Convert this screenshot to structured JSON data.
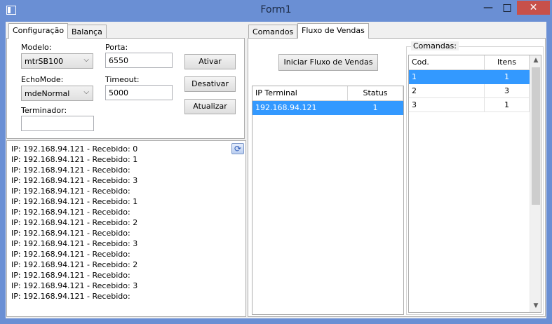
{
  "window": {
    "title": "Form1",
    "minimize": "—",
    "maximize": "□",
    "close": "✕"
  },
  "left_tabs": [
    {
      "label": "Configuração"
    },
    {
      "label": "Balança"
    }
  ],
  "config": {
    "modelo_label": "Modelo:",
    "modelo_value": "mtrSB100",
    "porta_label": "Porta:",
    "porta_value": "6550",
    "echomode_label": "EchoMode:",
    "echomode_value": "mdeNormal",
    "timeout_label": "Timeout:",
    "timeout_value": "5000",
    "terminador_label": "Terminador:",
    "terminador_value": "",
    "ativar": "Ativar",
    "desativar": "Desativar",
    "atualizar": "Atualizar"
  },
  "log": {
    "lines": [
      "IP: 192.168.94.121 - Recebido: 0",
      "IP: 192.168.94.121 - Recebido: 1",
      "IP: 192.168.94.121 - Recebido:",
      "IP: 192.168.94.121 - Recebido: 3",
      "IP: 192.168.94.121 - Recebido:",
      "IP: 192.168.94.121 - Recebido: 1",
      "IP: 192.168.94.121 - Recebido:",
      "IP: 192.168.94.121 - Recebido: 2",
      "IP: 192.168.94.121 - Recebido:",
      "IP: 192.168.94.121 - Recebido: 3",
      "IP: 192.168.94.121 - Recebido:",
      "IP: 192.168.94.121 - Recebido: 2",
      "IP: 192.168.94.121 - Recebido:",
      "IP: 192.168.94.121 - Recebido: 3",
      "IP: 192.168.94.121 - Recebido:"
    ],
    "refresh_icon": "refresh-icon"
  },
  "right_tabs": [
    {
      "label": "Comandos"
    },
    {
      "label": "Fluxo de Vendas"
    }
  ],
  "fluxo": {
    "iniciar": "Iniciar Fluxo de Vendas",
    "terminals": {
      "headers": [
        "IP Terminal",
        "Status"
      ],
      "rows": [
        [
          "192.168.94.121",
          "1"
        ]
      ]
    }
  },
  "comandas": {
    "title": "Comandas:",
    "headers": [
      "Cod.",
      "Itens"
    ],
    "rows": [
      [
        "1",
        "1"
      ],
      [
        "2",
        "3"
      ],
      [
        "3",
        "1"
      ]
    ],
    "scroll_up": "▲",
    "scroll_down": "▼"
  }
}
